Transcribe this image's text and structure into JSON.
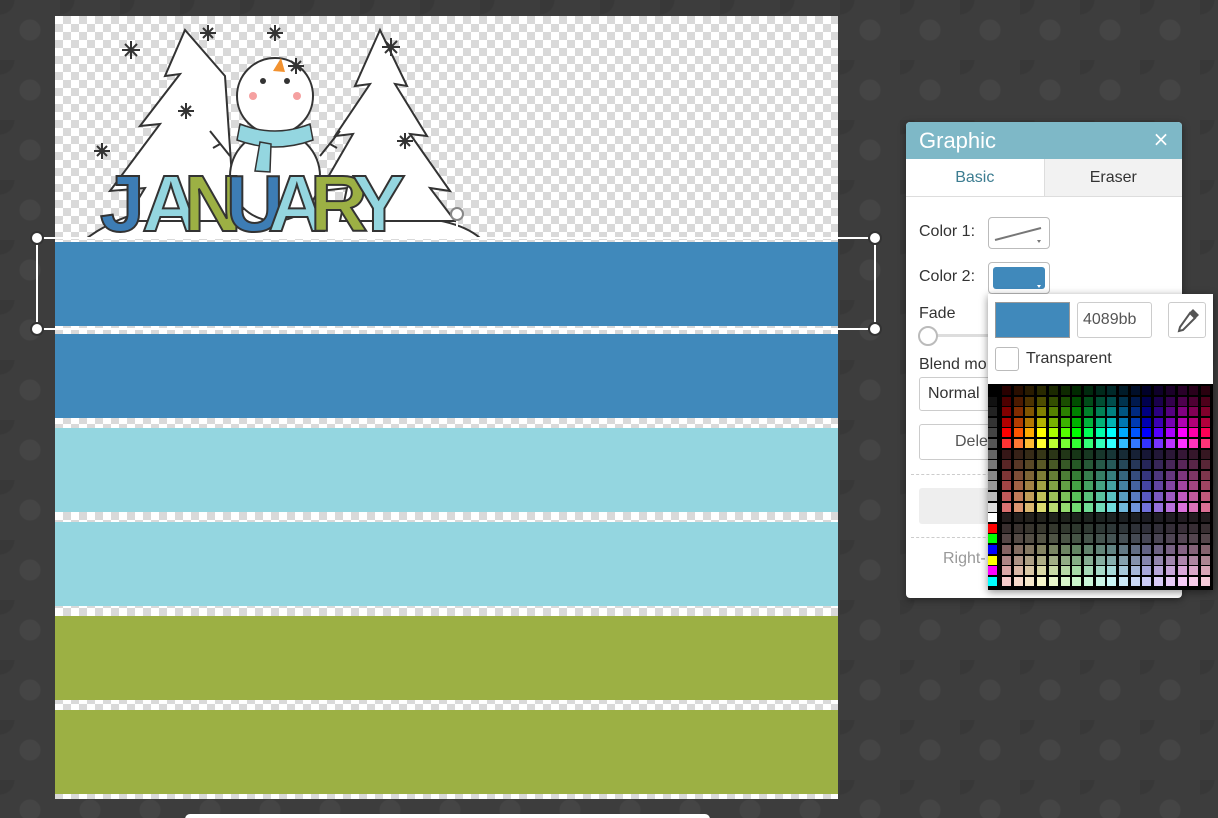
{
  "canvas": {
    "stripes": [
      {
        "color": "#4089bb"
      },
      {
        "color": "#4089bb"
      },
      {
        "color": "#94d6e0"
      },
      {
        "color": "#94d6e0"
      },
      {
        "color": "#9cb044"
      },
      {
        "color": "#9cb044"
      }
    ],
    "artwork_text": "JANUARY",
    "artwork_letter_colors": [
      "#3d7db5",
      "#94d6e0",
      "#9cb044",
      "#3d7db5",
      "#94d6e0",
      "#9cb044",
      "#94d6e0"
    ]
  },
  "panel": {
    "title": "Graphic",
    "close_glyph": "×",
    "tabs": [
      {
        "label": "Basic",
        "active": true
      },
      {
        "label": "Eraser",
        "active": false
      }
    ],
    "color1_label": "Color 1:",
    "color2_label": "Color 2:",
    "fade_label": "Fade",
    "blend_label": "Blend mo",
    "blend_value": "Normal",
    "delete_label": "Dele",
    "right_label": "Right-"
  },
  "color_popup": {
    "hex_value": "4089bb",
    "current_color": "#4089bb",
    "transparent_label": "Transparent",
    "transparent_checked": false
  },
  "icons": {
    "close": "close-icon",
    "eyedropper": "eyedropper-icon",
    "dropdown": "chevron-down-icon"
  }
}
